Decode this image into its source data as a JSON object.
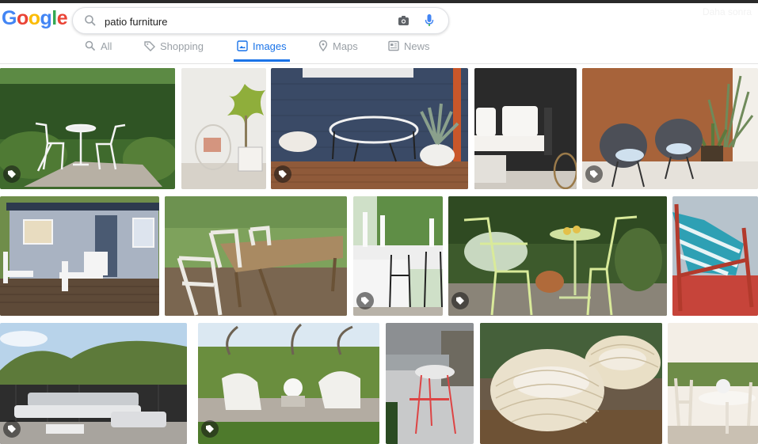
{
  "logo": {
    "letters": [
      "G",
      "o",
      "o",
      "g",
      "l",
      "e"
    ],
    "colors": [
      "#4285F4",
      "#EA4335",
      "#FBBC05",
      "#4285F4",
      "#34A853",
      "#EA4335"
    ]
  },
  "search": {
    "query": "patio furniture"
  },
  "later_link": "Daha sonra",
  "tabs": [
    {
      "label": "All",
      "icon": "search-icon"
    },
    {
      "label": "Shopping",
      "icon": "shopping-tag-icon"
    },
    {
      "label": "Images",
      "icon": "image-icon",
      "active": true
    },
    {
      "label": "Maps",
      "icon": "map-pin-icon"
    },
    {
      "label": "News",
      "icon": "news-icon"
    }
  ],
  "accent_color": "#1a73e8",
  "results": [
    {
      "subject": "white bistro set in garden"
    },
    {
      "subject": "white hanging chair by palm"
    },
    {
      "subject": "wire chair on grey deck"
    },
    {
      "subject": "white cushioned lounge chairs"
    },
    {
      "subject": "grey bucket chairs by wood wall"
    },
    {
      "subject": "shed with white adirondack chairs"
    },
    {
      "subject": "wooden dining set on deck"
    },
    {
      "subject": "white wedding table setting"
    },
    {
      "subject": "green metal bistro set"
    },
    {
      "subject": "striped red lounge chair"
    },
    {
      "subject": "grey modular outdoor sofa"
    },
    {
      "subject": "white chairs with fire pit"
    },
    {
      "subject": "grey stool on balcony"
    },
    {
      "subject": "wicker egg chairs"
    },
    {
      "subject": "white dining set with flowers"
    }
  ]
}
